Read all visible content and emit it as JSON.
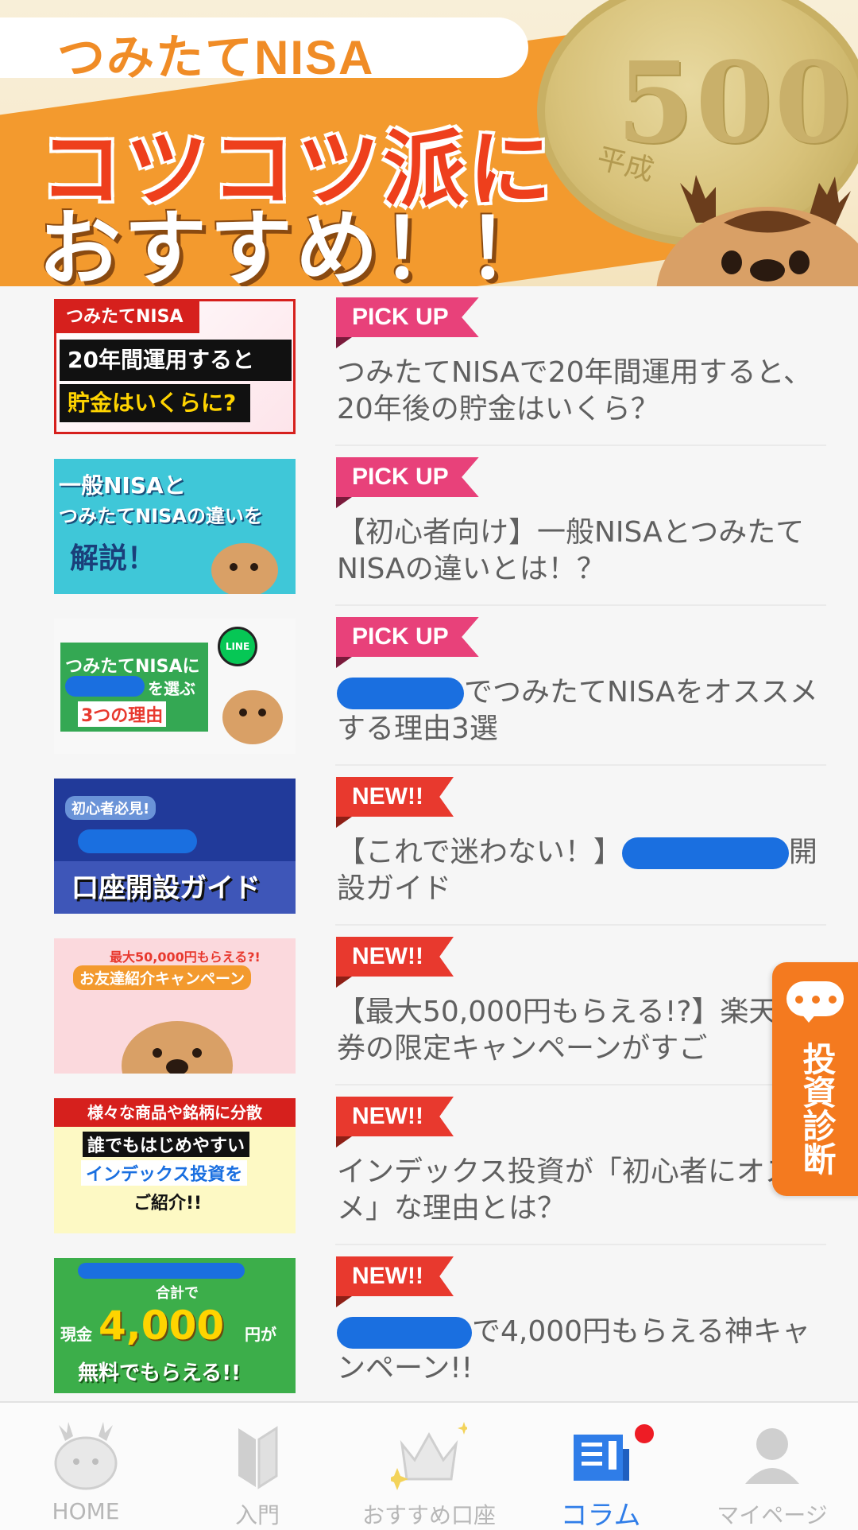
{
  "hero": {
    "pill_text": "つみたてNISA",
    "line1": "コツコツ派に",
    "line2": "おすすめ！！",
    "coin_value": "500",
    "coin_era": "平成"
  },
  "articles": [
    {
      "badge": "PICK UP",
      "title": "つみたてNISAで20年間運用すると、 20年後の貯金はいくら？",
      "thumb": {
        "top": "つみたてNISA",
        "l1": "20年間運用すると",
        "l2": "貯金はいくらに?"
      }
    },
    {
      "badge": "PICK UP",
      "title": "【初心者向け】一般NISAとつみたてNISAの違いとは！？",
      "thumb": {
        "l1": "一般NISAと",
        "l2": "つみたてNISAの違いを",
        "l3": "解説！"
      }
    },
    {
      "badge": "PICK UP",
      "title_suffix": "でつみたてNISAをオススメする理由3選",
      "thumb": {
        "l1": "つみたてNISAに",
        "l2": "を選ぶ",
        "l3": "3つの理由",
        "line": "LINE"
      }
    },
    {
      "badge": "NEW!!",
      "title_prefix": "【これで迷わない！】",
      "title_suffix": "開設ガイド",
      "thumb": {
        "l1": "初心者必見!",
        "l2": "口座開設ガイド"
      }
    },
    {
      "badge": "NEW!!",
      "title": "【最大50,000円もらえる!?】楽天証券の限定キャンペーンがすご",
      "thumb": {
        "l1": "最大50,000円もらえる?!",
        "l2": "お友達紹介キャンペーン"
      }
    },
    {
      "badge": "NEW!!",
      "title": "インデックス投資が「初心者にオススメ」な理由とは？",
      "thumb": {
        "l1": "様々な商品や銘柄に分散",
        "l2": "誰でもはじめやすい",
        "l3": "インデックス投資を",
        "l4": "ご紹介!!"
      }
    },
    {
      "badge": "NEW!!",
      "title_suffix": "で4,000円もらえる神キャンペーン!!",
      "thumb": {
        "l1": "合計で",
        "l2": "現金",
        "l3": "4,000",
        "l4": "円が",
        "l5": "無料でもらえる!!"
      }
    }
  ],
  "side_tab": {
    "label": "投資診断"
  },
  "nav": {
    "items": [
      {
        "label": "HOME",
        "icon": "deer-face-icon"
      },
      {
        "label": "入門",
        "icon": "beginner-mark-icon"
      },
      {
        "label": "おすすめ口座",
        "icon": "crown-icon"
      },
      {
        "label": "コラム",
        "icon": "newspaper-icon"
      },
      {
        "label": "マイページ",
        "icon": "user-icon"
      }
    ],
    "active": "コラム"
  },
  "colors": {
    "pick_badge": "#e8417a",
    "new_badge": "#e8392e",
    "active_nav": "#2f7de8",
    "side_tab": "#f47a1f"
  }
}
